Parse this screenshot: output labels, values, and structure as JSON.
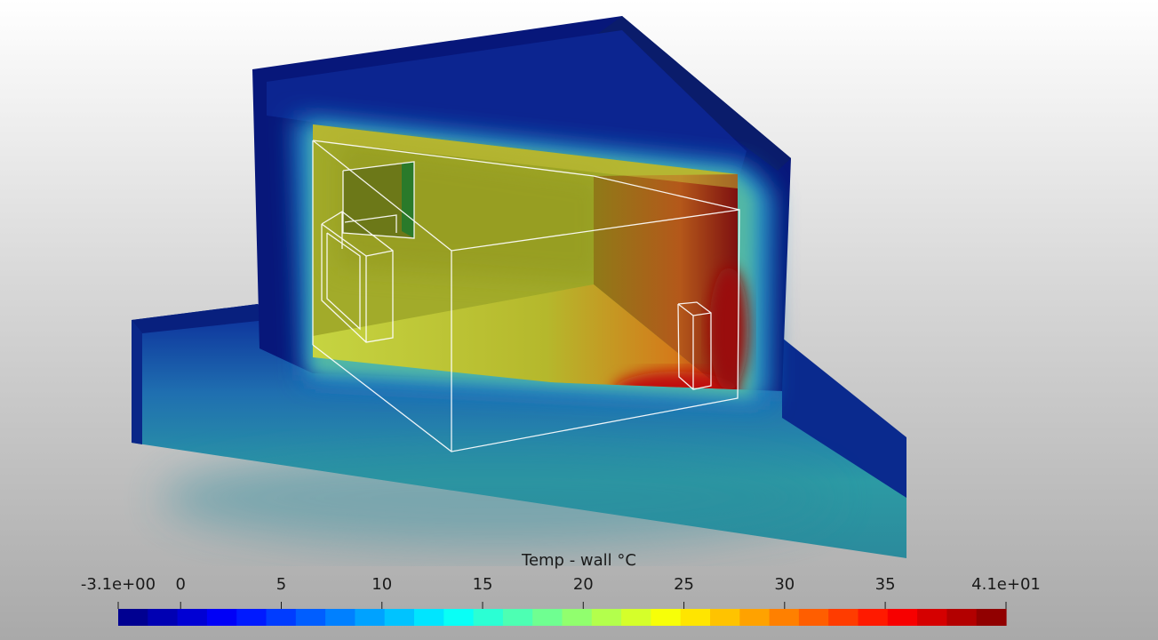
{
  "colorbar": {
    "title": "Temp - wall °C",
    "min_label": "-3.1e+00",
    "max_label": "4.1e+01",
    "min": -3.1,
    "max": 41,
    "ticks": [
      "0",
      "5",
      "10",
      "15",
      "20",
      "25",
      "30",
      "35"
    ],
    "colormap": "jet",
    "band_count": 30
  }
}
